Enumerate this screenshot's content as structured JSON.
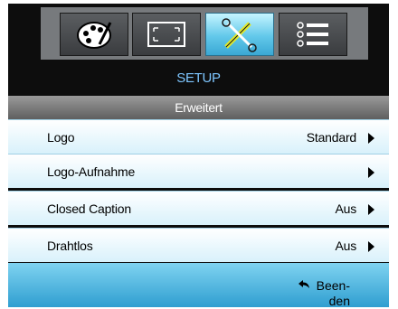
{
  "tabs": [
    {
      "name": "palette-icon"
    },
    {
      "name": "screen-icon"
    },
    {
      "name": "tools-icon",
      "active": true
    },
    {
      "name": "list-icon"
    }
  ],
  "title": "SETUP",
  "subheader": "Erweitert",
  "menu": [
    {
      "label": "Logo",
      "value": "Standard"
    },
    {
      "label": "Logo-Aufnahme",
      "value": ""
    },
    {
      "label": "Closed Caption",
      "value": "Aus"
    },
    {
      "label": "Drahtlos",
      "value": "Aus"
    }
  ],
  "footer": {
    "exit_line1": "Been-",
    "exit_line2": "den"
  },
  "colors": {
    "accent": "#7ec6ff",
    "active_tab": "#62c8ea",
    "row_bg": "#d8f1fb",
    "footer": "#2f9ed0"
  }
}
